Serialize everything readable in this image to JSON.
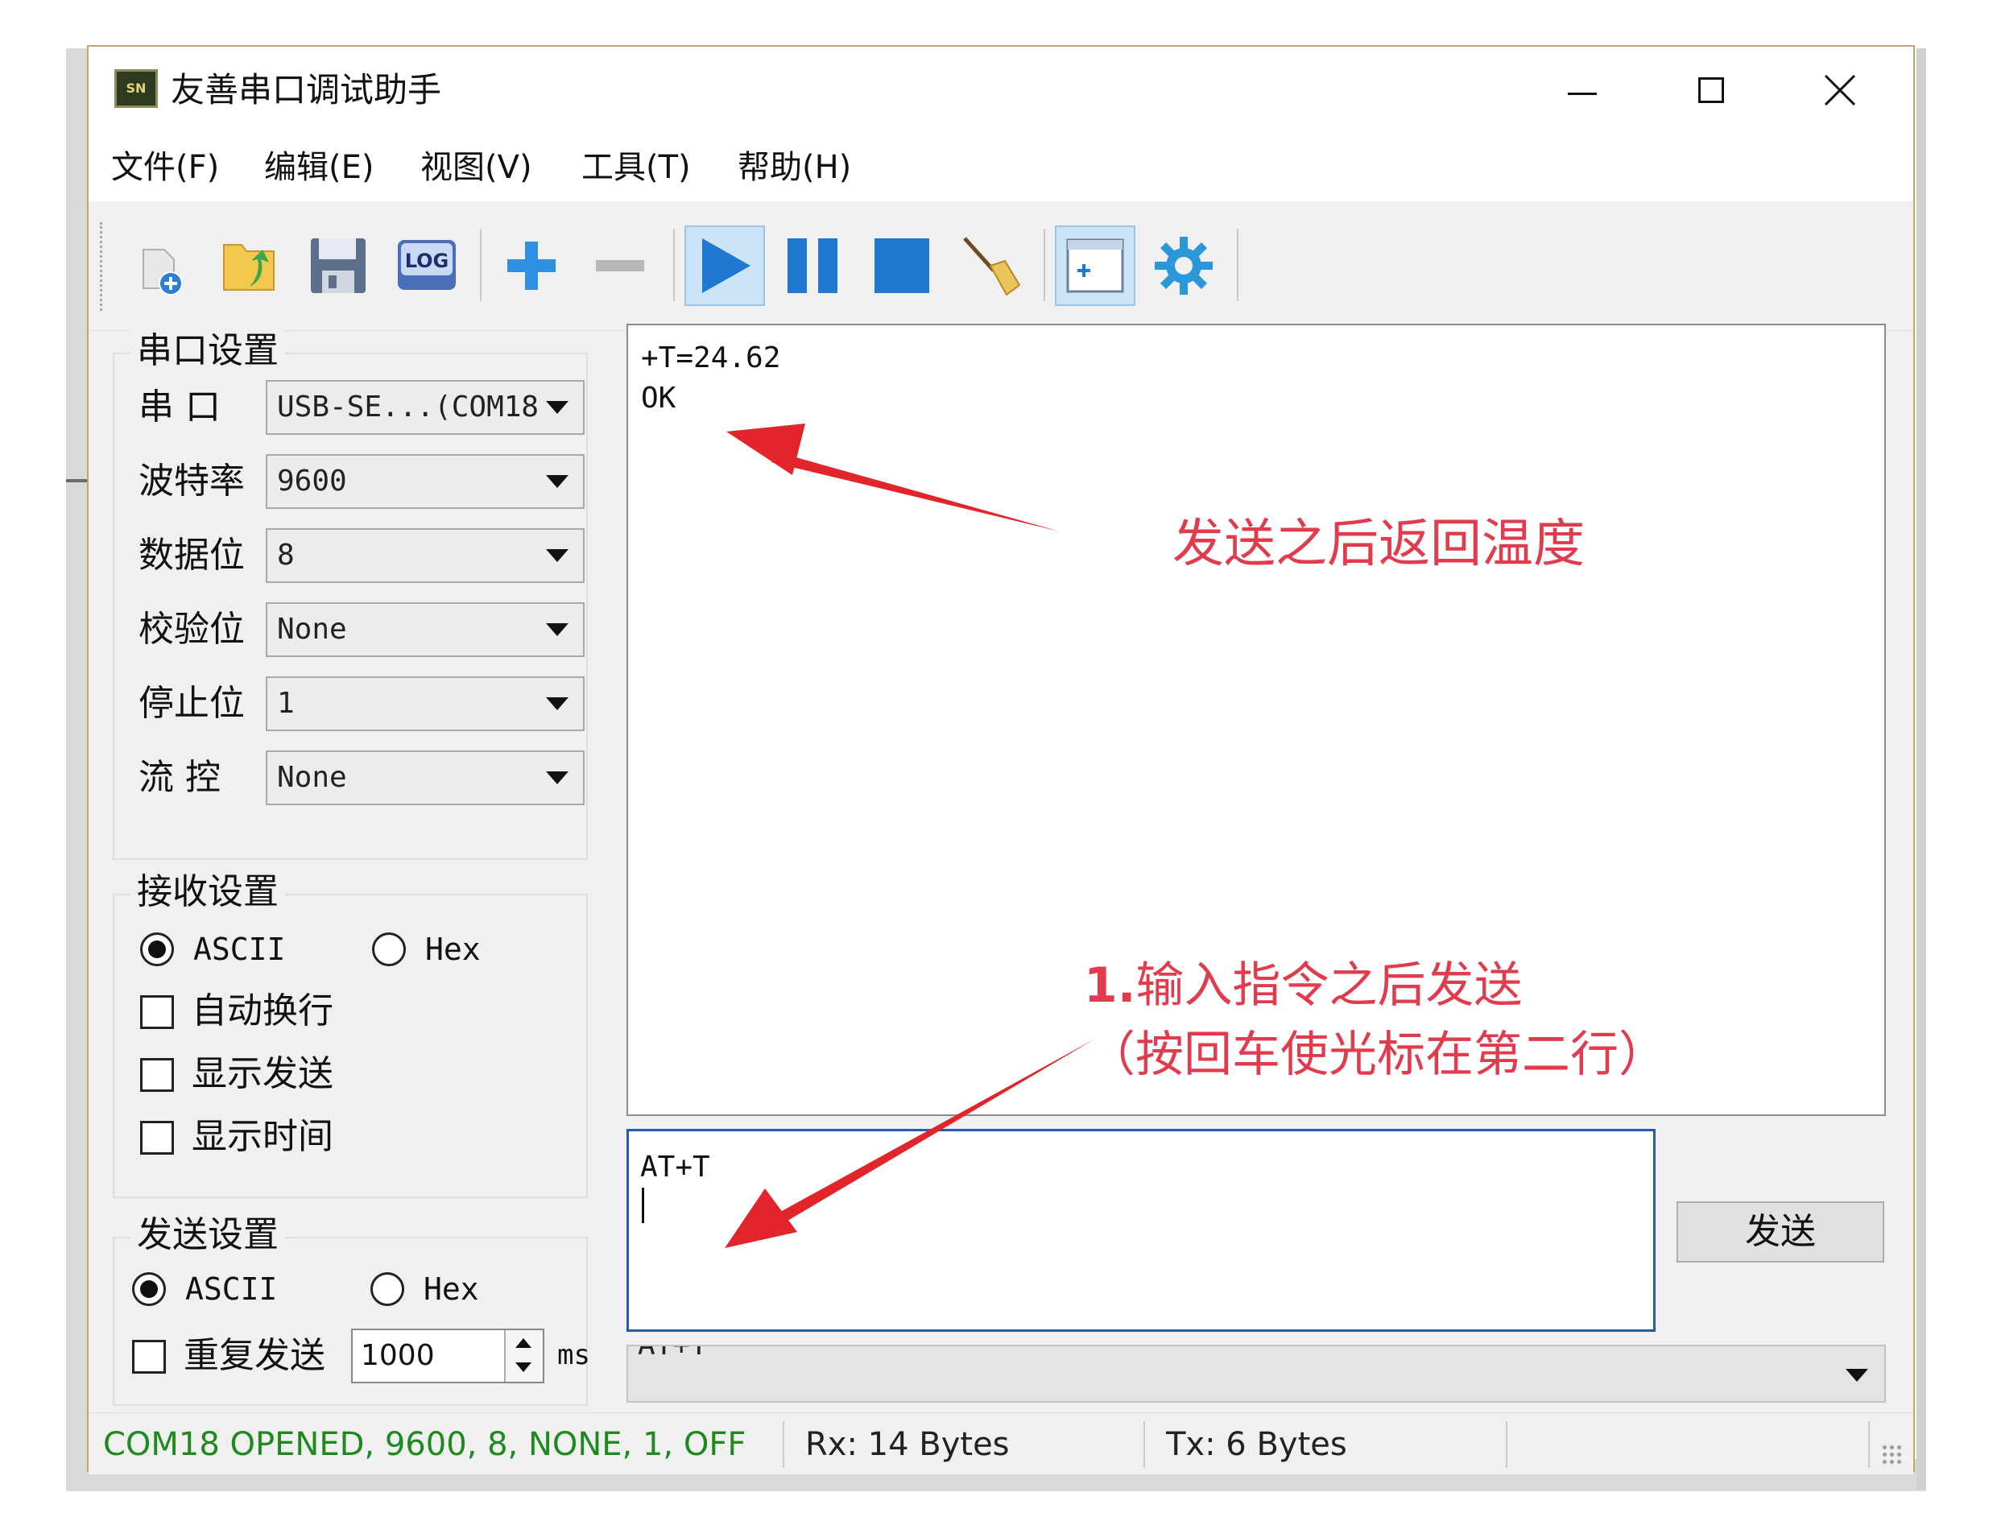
{
  "window": {
    "title": "友善串口调试助手",
    "app_icon_text": "SN"
  },
  "menu": [
    "文件(F)",
    "编辑(E)",
    "视图(V)",
    "工具(T)",
    "帮助(H)"
  ],
  "toolbar": {
    "log_label": "LOG",
    "icons": [
      "new-file-icon",
      "open-folder-icon",
      "save-icon",
      "log-icon",
      "add-icon",
      "remove-icon",
      "play-icon",
      "pause-icon",
      "stop-icon",
      "broom-icon",
      "add-window-icon",
      "settings-gear-icon"
    ]
  },
  "serial_settings": {
    "title": "串口设置",
    "fields": [
      {
        "label": "串    口",
        "value": "USB-SE...(COM18"
      },
      {
        "label": "波特率",
        "value": "9600"
      },
      {
        "label": "数据位",
        "value": "8"
      },
      {
        "label": "校验位",
        "value": "None"
      },
      {
        "label": "停止位",
        "value": "1"
      },
      {
        "label": "流    控",
        "value": "None"
      }
    ]
  },
  "receive_settings": {
    "title": "接收设置",
    "ascii_label": "ASCII",
    "hex_label": "Hex",
    "selected": "ASCII",
    "checkboxes": [
      "自动换行",
      "显示发送",
      "显示时间"
    ]
  },
  "send_settings": {
    "title": "发送设置",
    "ascii_label": "ASCII",
    "hex_label": "Hex",
    "selected": "ASCII",
    "repeat_label": "重复发送",
    "interval": "1000",
    "unit": "ms"
  },
  "receive_area": {
    "lines": [
      "+T=24.62",
      "OK"
    ]
  },
  "send_area": {
    "text": "AT+T"
  },
  "send_button_label": "发送",
  "history": {
    "value": "AT+T"
  },
  "status": {
    "connection": "COM18 OPENED, 9600, 8, NONE, 1, OFF",
    "rx": "Rx: 14 Bytes",
    "tx": "Tx: 6 Bytes",
    "connection_color": "#1e8a1e"
  },
  "annotations": {
    "top_note": "发送之后返回温度",
    "bottom_note_num": "1.",
    "bottom_note_line1": "输入指令之后发送",
    "bottom_note_line2": "（按回车使光标在第二行）",
    "color": "#e23b4d"
  }
}
